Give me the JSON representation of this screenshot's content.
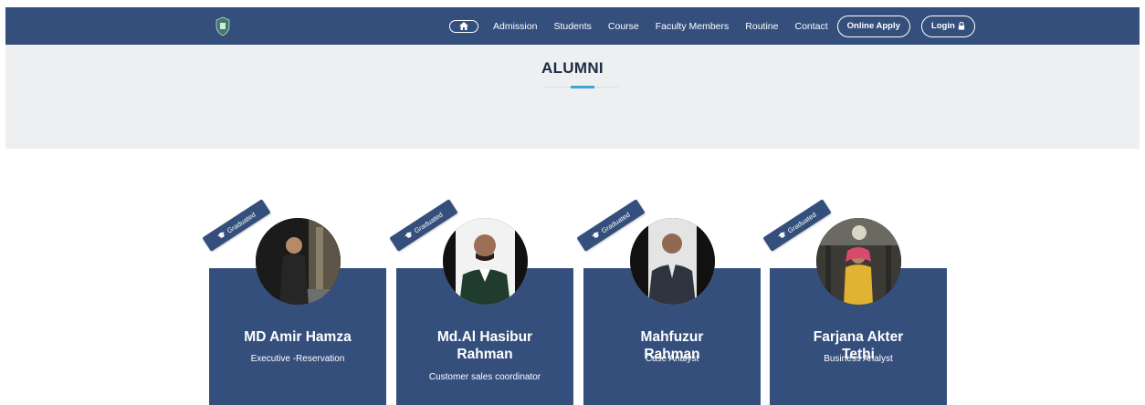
{
  "nav": {
    "links": [
      "Admission",
      "Students",
      "Course",
      "Faculty Members",
      "Routine",
      "Contact"
    ],
    "apply_label": "Online Apply",
    "login_label": "Login"
  },
  "hero": {
    "title": "ALUMNI"
  },
  "alumni": [
    {
      "badge": "Graduated",
      "name": "MD Amir Hamza",
      "role": "Executive -Reservation"
    },
    {
      "badge": "Graduated",
      "name": "Md.Al Hasibur Rahman",
      "role": "Customer sales coordinator"
    },
    {
      "badge": "Graduated",
      "name": "Mahfuzur Rahman",
      "role": "Case Analyst"
    },
    {
      "badge": "Graduated",
      "name": "Farjana Akter Tethi",
      "role": "Business Analyst"
    }
  ],
  "colors": {
    "navbar": "#354f7d",
    "hero_bg": "#edeff1",
    "accent": "#3da6d6",
    "card": "#354f7d"
  }
}
